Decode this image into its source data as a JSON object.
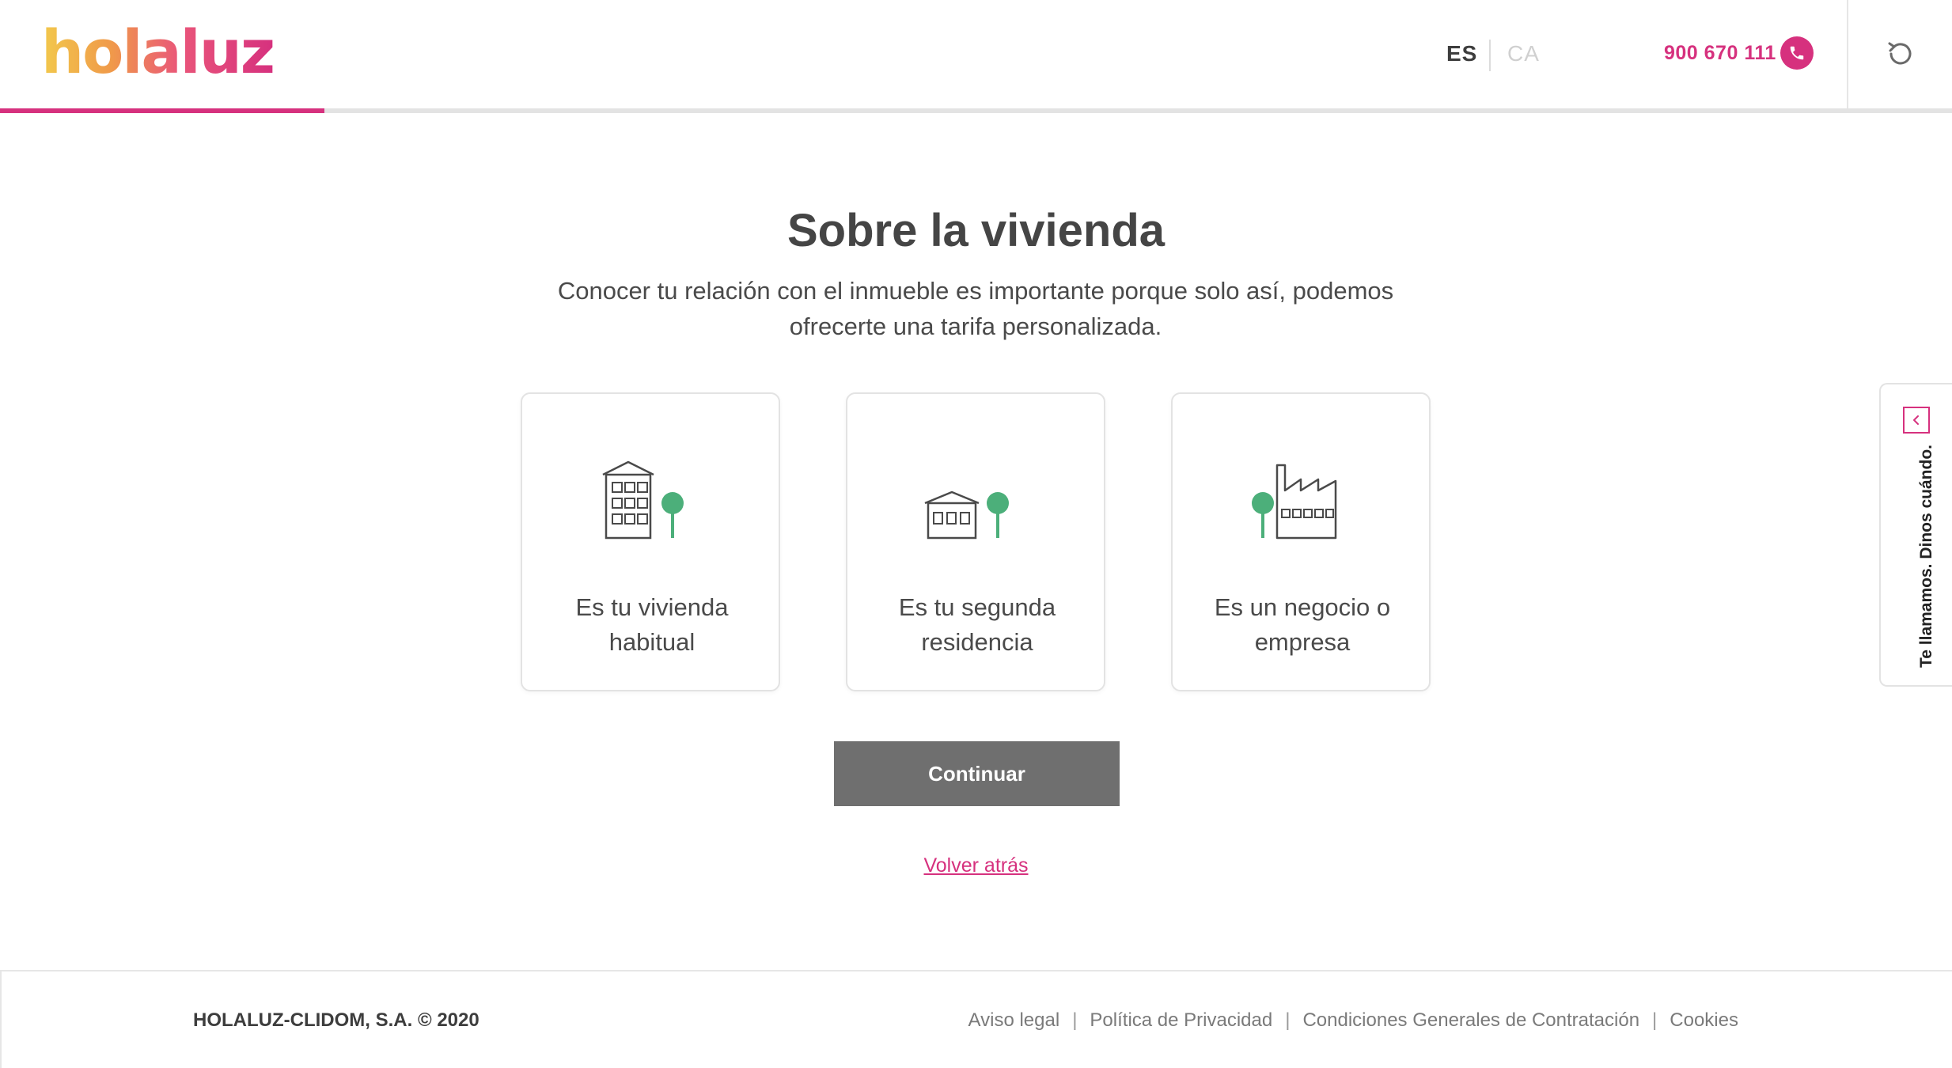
{
  "header": {
    "logo_text": "holaluz",
    "languages": [
      {
        "code": "ES",
        "active": true
      },
      {
        "code": "CA",
        "active": false
      }
    ],
    "phone": "900 670 111",
    "progress_fraction": 0.166
  },
  "main": {
    "title": "Sobre la vivienda",
    "subtitle": "Conocer tu relación con el inmueble es importante porque solo así, podemos ofrecerte una tarifa personalizada.",
    "options": [
      {
        "label": "Es tu vivienda habitual",
        "icon": "apartment-building-icon"
      },
      {
        "label": "Es tu segunda residencia",
        "icon": "house-icon"
      },
      {
        "label": "Es un negocio o empresa",
        "icon": "factory-icon"
      }
    ],
    "continue_label": "Continuar",
    "back_label": "Volver atrás"
  },
  "side_tab": {
    "label": "Te llamamos. Dinos cuándo."
  },
  "footer": {
    "copyright": "HOLALUZ-CLIDOM, S.A. © 2020",
    "links": [
      "Aviso legal",
      "Política de Privacidad",
      "Condiciones Generales de Contratación",
      "Cookies"
    ]
  },
  "colors": {
    "brand_pink": "#d6317e",
    "tree_green": "#4caf7a",
    "button_gray": "#6f6f6f"
  }
}
